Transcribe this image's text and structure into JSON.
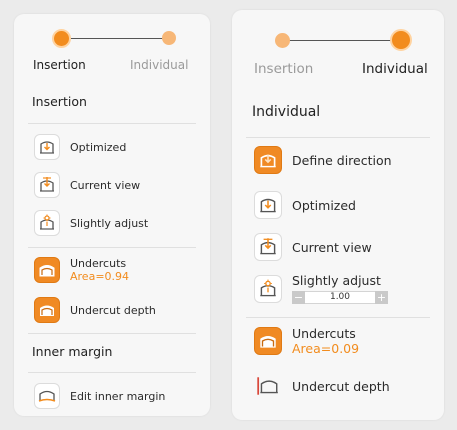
{
  "colors": {
    "accent": "#f28c1e",
    "panel": "#f7f7f7",
    "background": "#ebebeb"
  },
  "left_panel": {
    "steps": [
      {
        "label": "Insertion"
      },
      {
        "label": "Individual"
      }
    ],
    "section_title": "Insertion",
    "items": [
      {
        "label": "Optimized",
        "icon": "insertion-optimized-icon"
      },
      {
        "label": "Current view",
        "icon": "current-view-icon"
      },
      {
        "label": "Slightly adjust",
        "icon": "slightly-adjust-icon"
      }
    ],
    "undercuts": {
      "label": "Undercuts",
      "area": "Area=0.94",
      "icon": "undercuts-icon"
    },
    "undercut_depth": {
      "label": "Undercut depth",
      "icon": "undercut-depth-icon"
    },
    "inner_margin_title": "Inner margin",
    "edit_inner_margin": {
      "label": "Edit inner margin",
      "icon": "inner-margin-icon"
    }
  },
  "right_panel": {
    "steps": [
      {
        "label": "Insertion"
      },
      {
        "label": "Individual"
      }
    ],
    "section_title": "Individual",
    "define_direction": {
      "label": "Define direction",
      "icon": "define-direction-icon"
    },
    "items": [
      {
        "label": "Optimized",
        "icon": "insertion-optimized-icon"
      },
      {
        "label": "Current view",
        "icon": "current-view-icon"
      }
    ],
    "slightly_adjust": {
      "label": "Slightly adjust",
      "value": "1.00",
      "minus": "−",
      "plus": "+",
      "icon": "slightly-adjust-icon"
    },
    "undercuts": {
      "label": "Undercuts",
      "area": "Area=0.09",
      "icon": "undercuts-icon"
    },
    "undercut_depth": {
      "label": "Undercut depth",
      "icon": "undercut-depth-icon"
    }
  }
}
